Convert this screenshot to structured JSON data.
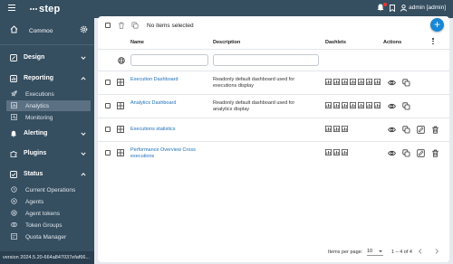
{
  "app": {
    "logo_text": "step"
  },
  "topbar": {
    "user_label": "admin [admin]",
    "icons": [
      "menu-icon",
      "bell-icon",
      "bookmark-icon",
      "user-icon"
    ]
  },
  "sidebar": {
    "workspace": {
      "name": "Commoo"
    },
    "sections": [
      {
        "label": "Design",
        "icon": "edit-icon",
        "expanded": false
      },
      {
        "label": "Reporting",
        "icon": "chart-icon",
        "expanded": true
      },
      {
        "label": "Alerting",
        "icon": "bell-icon",
        "expanded": false
      },
      {
        "label": "Plugins",
        "icon": "puzzle-icon",
        "expanded": false
      },
      {
        "label": "Status",
        "icon": "checkbox-icon",
        "expanded": true
      }
    ],
    "reporting_items": [
      {
        "label": "Executions",
        "icon": "rocket-icon",
        "active": false
      },
      {
        "label": "Analytics",
        "icon": "analytics-icon",
        "active": true
      },
      {
        "label": "Monitoring",
        "icon": "monitoring-icon",
        "active": false
      }
    ],
    "status_items": [
      {
        "label": "Current Operations",
        "icon": "operations-icon"
      },
      {
        "label": "Agents",
        "icon": "agent-icon"
      },
      {
        "label": "Agent tokens",
        "icon": "token-icon"
      },
      {
        "label": "Token Groups",
        "icon": "token-group-icon"
      },
      {
        "label": "Quota Manager",
        "icon": "quota-icon"
      }
    ],
    "version": "version 2024.5.20-664a847037efaf66..."
  },
  "toolbar": {
    "selection_text": "No items selected",
    "add_label": "+"
  },
  "table": {
    "headers": {
      "name": "Name",
      "description": "Description",
      "dashlets": "Dashlets",
      "actions": "Actions"
    },
    "filters": {
      "name_value": "",
      "description_value": ""
    },
    "rows": [
      {
        "name": "Execution Dashboard",
        "description": "Readonly default dashboard used for executions display",
        "dashlets": 7,
        "readonly": true
      },
      {
        "name": "Analytics Dashboard",
        "description": "Readonly default dashboard used for analytics display",
        "dashlets": 7,
        "readonly": true
      },
      {
        "name": "Executions statistics",
        "description": "",
        "dashlets": 3,
        "readonly": false
      },
      {
        "name": "Performance Overview Cross executions",
        "description": "",
        "dashlets": 3,
        "readonly": false
      }
    ]
  },
  "pagination": {
    "items_per_page_label": "Items per page:",
    "page_size": "10",
    "range_label": "1 – 4 of 4"
  },
  "colors": {
    "sidebar": "#354e60",
    "accent": "#1a86d6",
    "link": "#1e6fb9",
    "active_nav": "#5b7183"
  }
}
